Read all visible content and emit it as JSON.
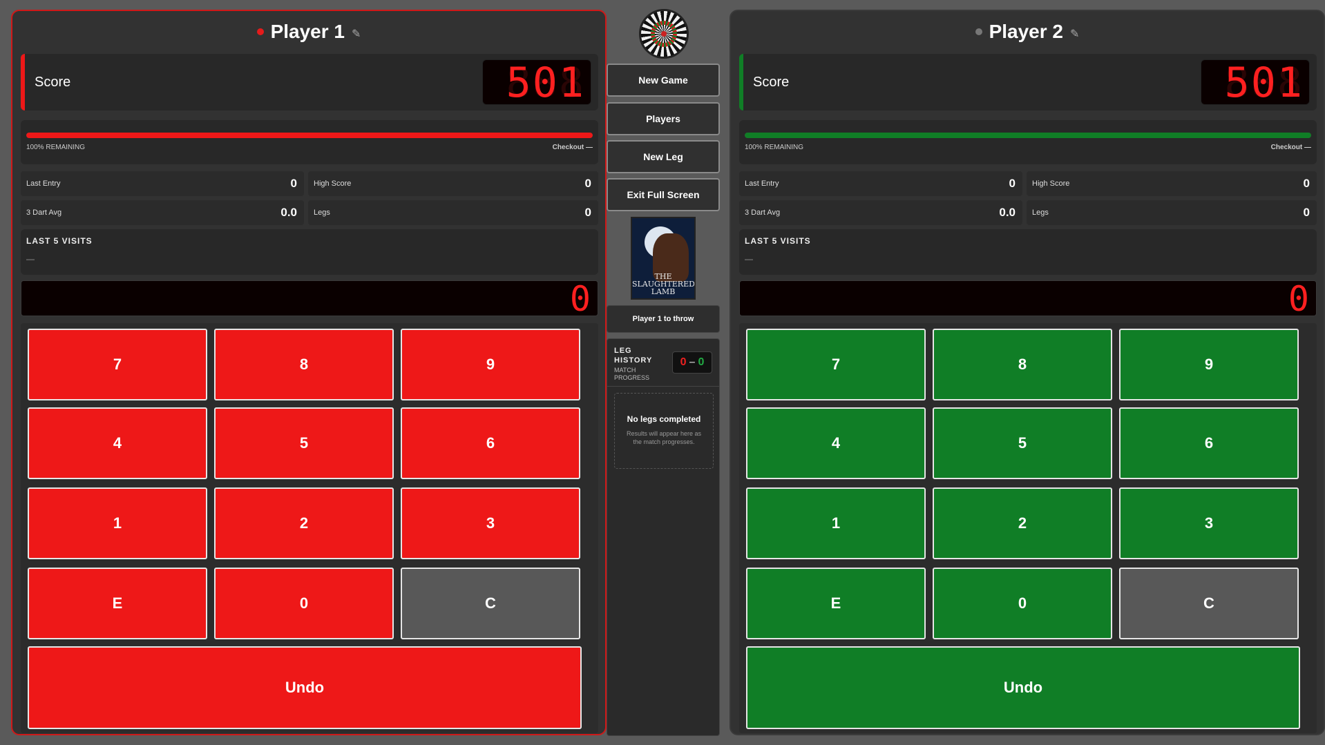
{
  "player1": {
    "name": "Player 1",
    "score_label": "Score",
    "score": "501",
    "remaining_label": "100% REMAINING",
    "remaining_fraction": 1.0,
    "checkout_label": "Checkout —",
    "last_entry_label": "Last Entry",
    "last_entry": "0",
    "high_score_label": "High Score",
    "high_score": "0",
    "avg_label": "3 Dart Avg",
    "avg": "0.0",
    "legs_label": "Legs",
    "legs": "0",
    "visits_label": "LAST 5 VISITS",
    "visits_value": "—",
    "entry_value": "0",
    "color": "#ee1818",
    "status_dot_color": "#e51b1b"
  },
  "player2": {
    "name": "Player 2",
    "score_label": "Score",
    "score": "501",
    "remaining_label": "100% REMAINING",
    "remaining_fraction": 1.0,
    "checkout_label": "Checkout —",
    "last_entry_label": "Last Entry",
    "last_entry": "0",
    "high_score_label": "High Score",
    "high_score": "0",
    "avg_label": "3 Dart Avg",
    "avg": "0.0",
    "legs_label": "Legs",
    "legs": "0",
    "visits_label": "LAST 5 VISITS",
    "visits_value": "—",
    "entry_value": "0",
    "color": "#107e26",
    "status_dot_color": "#777777"
  },
  "keypad": {
    "k7": "7",
    "k8": "8",
    "k9": "9",
    "k4": "4",
    "k5": "5",
    "k6": "6",
    "k1": "1",
    "k2": "2",
    "k3": "3",
    "kE": "E",
    "k0": "0",
    "kC": "C",
    "undo": "Undo"
  },
  "center": {
    "new_game": "New Game",
    "players": "Players",
    "new_leg": "New Leg",
    "exit_fullscreen": "Exit Full Screen",
    "poster_line1": "THE",
    "poster_line2": "SLAUGHTERED",
    "poster_line3": "LAMB",
    "turn_text": "Player 1 to throw",
    "leg_history_title": "LEG HISTORY",
    "leg_history_subtitle": "MATCH PROGRESS",
    "leg_score_p1": "0",
    "leg_score_sep": "–",
    "leg_score_p2": "0",
    "no_legs_title": "No legs completed",
    "no_legs_text": "Results will appear here as the match progresses."
  },
  "icons": {
    "edit": "pencil-icon",
    "board": "dartboard-icon"
  }
}
